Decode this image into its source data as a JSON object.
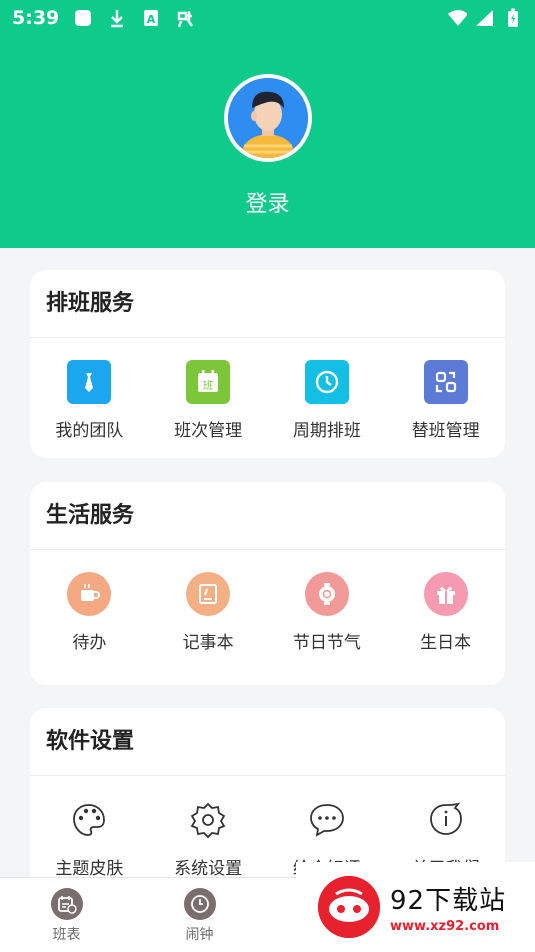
{
  "status_bar": {
    "time": "5:39",
    "icons_left": [
      "square-icon",
      "download-icon",
      "a-icon",
      "bug-icon"
    ],
    "icons_right": [
      "wifi-icon",
      "signal-icon",
      "battery-icon"
    ]
  },
  "header": {
    "login_label": "登录",
    "accent": "#0fcb8b"
  },
  "sections": [
    {
      "title": "排班服务",
      "items": [
        {
          "label": "我的团队",
          "icon": "tie-icon",
          "color": "#1aa7ef"
        },
        {
          "label": "班次管理",
          "icon": "calendar-icon",
          "color": "#7cc63a",
          "glyph": "班"
        },
        {
          "label": "周期排班",
          "icon": "clock-icon",
          "color": "#14bfe6"
        },
        {
          "label": "替班管理",
          "icon": "swap-icon",
          "color": "#5b7bd6"
        }
      ]
    },
    {
      "title": "生活服务",
      "items": [
        {
          "label": "待办",
          "icon": "cup-icon",
          "color": "#f5a983"
        },
        {
          "label": "记事本",
          "icon": "notebook-icon",
          "color": "#f3b085"
        },
        {
          "label": "节日节气",
          "icon": "lantern-icon",
          "color": "#f29a98"
        },
        {
          "label": "生日本",
          "icon": "gift-icon",
          "color": "#f59ab0"
        }
      ]
    },
    {
      "title": "软件设置",
      "items": [
        {
          "label": "主题皮肤",
          "icon": "palette-icon"
        },
        {
          "label": "系统设置",
          "icon": "gear-icon"
        },
        {
          "label": "给个好评",
          "icon": "chat-bubble-icon"
        },
        {
          "label": "关于我们",
          "icon": "info-bubble-icon"
        }
      ]
    }
  ],
  "bottom_nav": [
    {
      "label": "班表",
      "icon": "schedule-icon"
    },
    {
      "label": "闹钟",
      "icon": "alarm-clock-icon"
    }
  ],
  "watermark": {
    "title": "92下载站",
    "url": "www.xz92.com"
  }
}
